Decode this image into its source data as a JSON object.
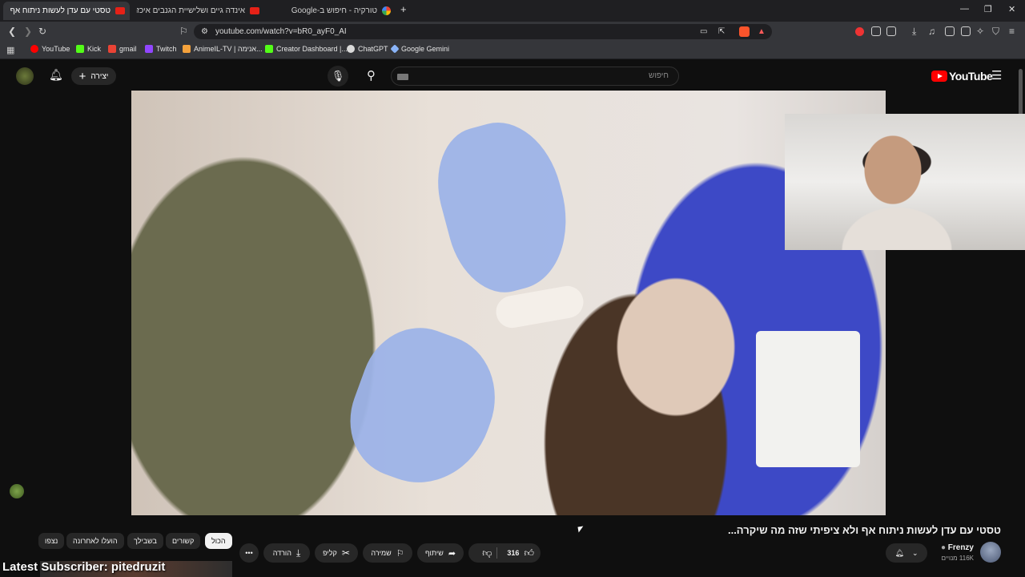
{
  "browser": {
    "tabs": [
      {
        "label": "טסטי עם עדן לעשות ניתוח אף",
        "active": true
      },
      {
        "label": "אינדה גיים ושלישיית הגנבים איכזה את",
        "active": false
      },
      {
        "label": "טורקיה - חיפוש ב-Google",
        "active": false
      }
    ],
    "new_tab": "+",
    "url": "youtube.com/watch?v=bR0_ayF0_AI",
    "bookmarks": [
      {
        "label": "YouTube",
        "color": "#ff0000"
      },
      {
        "label": "Kick",
        "color": "#53fc18"
      },
      {
        "label": "gmail",
        "color": "#ea4335"
      },
      {
        "label": "Twitch",
        "color": "#9146ff"
      },
      {
        "label": "AnimeIL-TV | אנימה...",
        "color": "#f4a23c"
      },
      {
        "label": "Creator Dashboard |...",
        "color": "#53fc18"
      },
      {
        "label": "ChatGPT",
        "color": "#d9d9d9"
      },
      {
        "label": "Google Gemini",
        "color": "#8ab4f8"
      }
    ]
  },
  "youtube": {
    "logo_text": "YouTube",
    "search_placeholder": "חיפוש",
    "create_label": "יצירה"
  },
  "video": {
    "title": "טסטי עם עדן לעשות ניתוח אף ולא ציפיתי שזה מה שיקרה...",
    "channel_name": "Frenzy",
    "subscribers": "116K מנויים",
    "likes": "316",
    "share_label": "שיתוף",
    "save_label": "שמירה",
    "clip_label": "קליפ",
    "download_label": "הורדה"
  },
  "chips": [
    "הכול",
    "קשורים",
    "בשבילך",
    "הועלו לאחרונה",
    "נצפו"
  ],
  "overlay": {
    "subscriber_text": "Latest Subscriber: pitedruzit"
  }
}
